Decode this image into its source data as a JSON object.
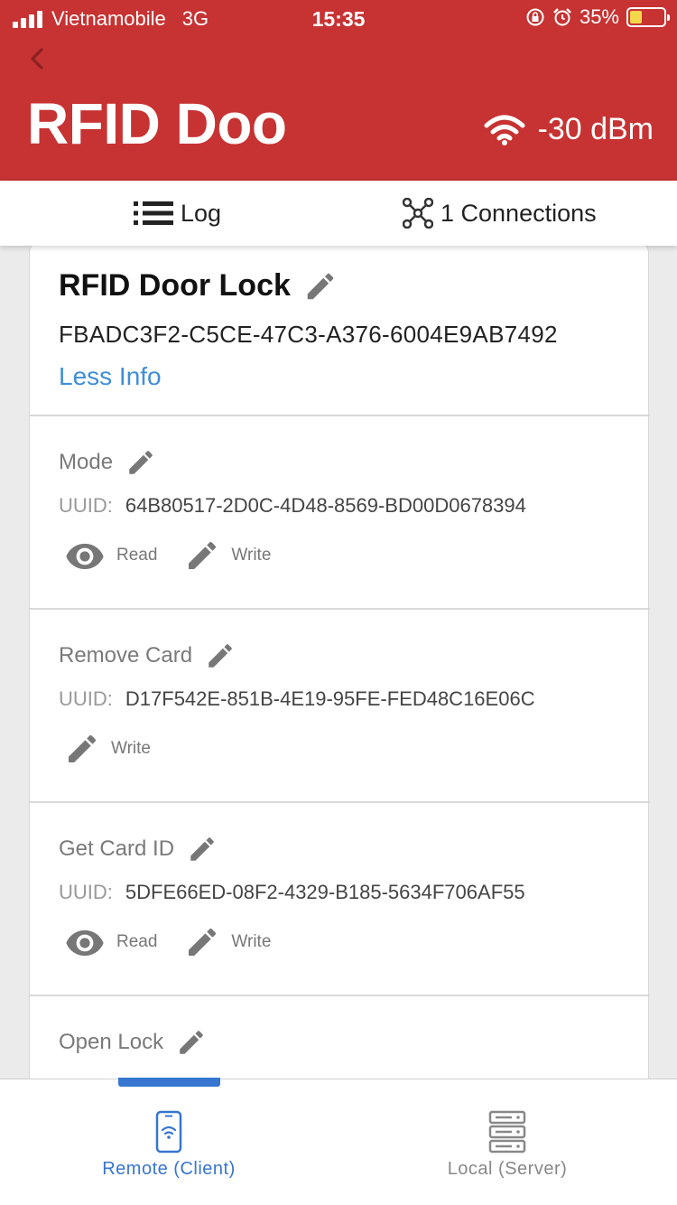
{
  "status_bar": {
    "carrier": "Vietnamobile",
    "network": "3G",
    "time": "15:35",
    "battery": "35%",
    "battery_color": "#f6d64d"
  },
  "header": {
    "back_icon": "chevron-left-icon",
    "title": "RFID Doo",
    "rssi": "-30 dBm",
    "background": "#c73232"
  },
  "tabs": {
    "log_label": "Log",
    "connections_label": "1 Connections"
  },
  "device": {
    "name": "RFID Door Lock",
    "uuid": "FBADC3F2-C5CE-47C3-A376-6004E9AB7492",
    "less_info": "Less Info",
    "link_color": "#3f8ed9"
  },
  "characteristics": [
    {
      "name": "Mode",
      "uuid_label": "UUID:",
      "uuid": "64B80517-2D0C-4D48-8569-BD00D0678394",
      "read_label": "Read",
      "write_label": "Write"
    },
    {
      "name": "Remove Card",
      "uuid_label": "UUID:",
      "uuid": "D17F542E-851B-4E19-95FE-FED48C16E06C",
      "write_label": "Write"
    },
    {
      "name": "Get Card ID",
      "uuid_label": "UUID:",
      "uuid": "5DFE66ED-08F2-4329-B185-5634F706AF55",
      "read_label": "Read",
      "write_label": "Write"
    },
    {
      "name": "Open Lock"
    }
  ],
  "bottom_nav": {
    "remote_label": "Remote (Client)",
    "local_label": "Local (Server)",
    "active_color": "#3676d0"
  }
}
